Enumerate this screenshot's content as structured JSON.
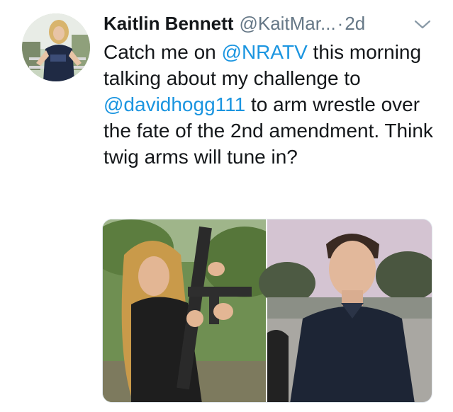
{
  "tweet": {
    "display_name": "Kaitlin Bennett",
    "handle": "@KaitMar...",
    "separator": "·",
    "timestamp": "2d",
    "text_segments": [
      {
        "type": "text",
        "text": "Catch me on "
      },
      {
        "type": "mention",
        "text": "@NRATV"
      },
      {
        "type": "text",
        "text": " this morning talking about my challenge to "
      },
      {
        "type": "mention",
        "text": "@davidhogg111"
      },
      {
        "type": "text",
        "text": " to arm wrestle over the fate of the 2nd amendment. Think twig arms will tune in?"
      }
    ]
  },
  "icons": {
    "menu": "chevron-down-icon"
  },
  "colors": {
    "link": "#1b95e0",
    "secondary_text": "#657786",
    "primary_text": "#14171a",
    "background": "#ffffff"
  }
}
